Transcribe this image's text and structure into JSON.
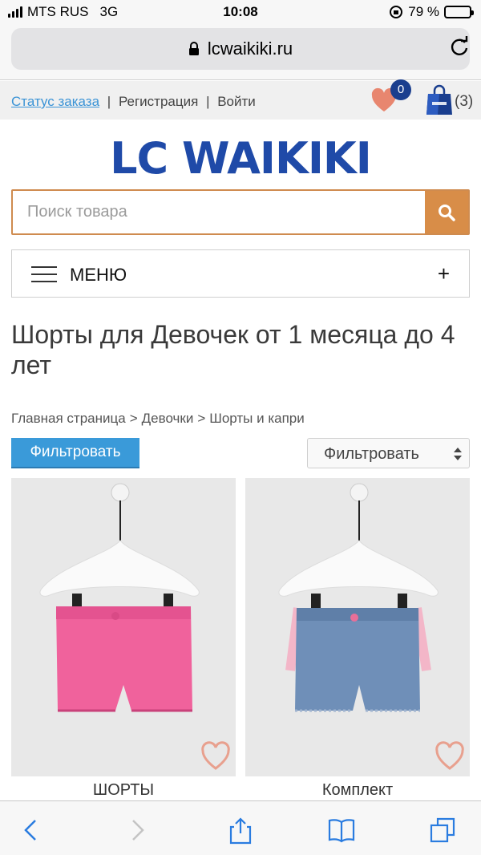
{
  "status_bar": {
    "carrier": "MTS RUS",
    "network": "3G",
    "time": "10:08",
    "battery": "79 %",
    "battery_level": 0.79
  },
  "browser": {
    "url": "lcwaikiki.ru"
  },
  "top_links": {
    "order_status": "Статус заказа",
    "separator": "|",
    "register": "Регистрация",
    "login": "Войти",
    "wishlist_count": "0",
    "cart_count": "(3)"
  },
  "logo": "LC WAIKIKI",
  "search": {
    "placeholder": "Поиск товара"
  },
  "menu": {
    "label": "МЕНЮ",
    "expand": "+"
  },
  "page_title": "Шорты для Девочек от 1 месяца до 4 лет",
  "breadcrumb": {
    "home": "Главная страница",
    "separator": ">",
    "girls": "Девочки",
    "current": "Шорты и капри"
  },
  "filter_button": "Фильтровать",
  "sort_select": "Фильтровать",
  "products": [
    {
      "name": "ШОРТЫ",
      "color": "#f0629c"
    },
    {
      "name": "Комплект",
      "color": "#6f8fb8"
    }
  ],
  "colors": {
    "accent_blue": "#3a9ad9",
    "brand_blue": "#1f4aa8",
    "search_orange": "#d88d48",
    "heart": "#e8866f"
  }
}
